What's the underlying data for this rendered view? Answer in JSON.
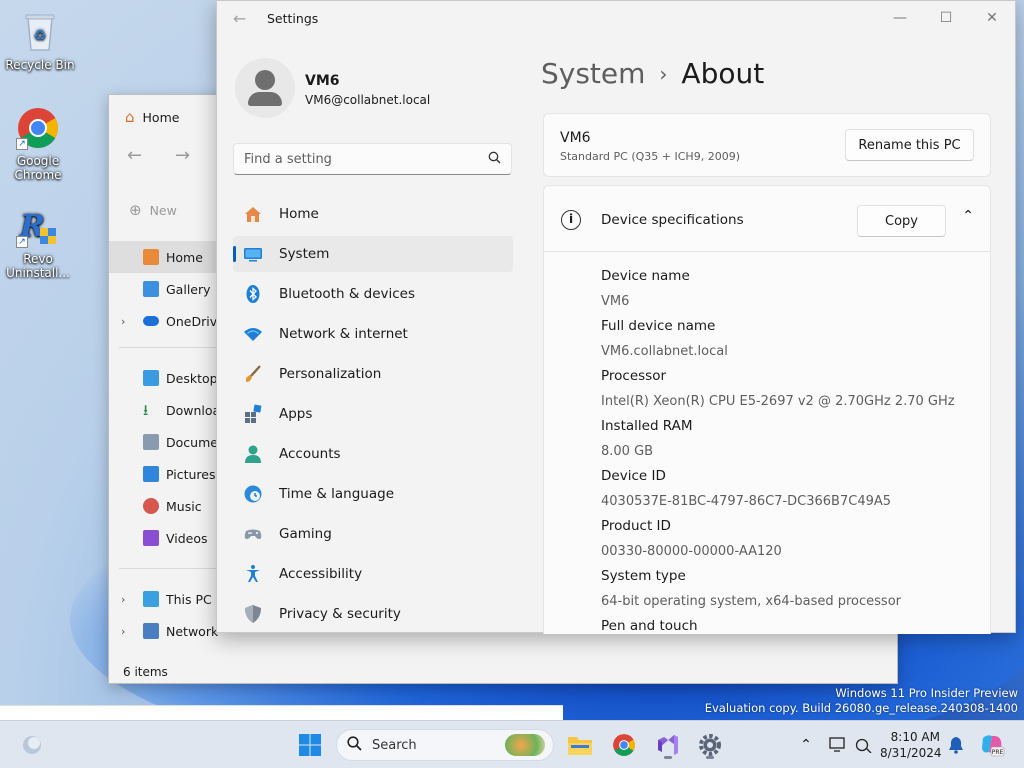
{
  "desktop": {
    "icons": [
      {
        "label": "Recycle Bin"
      },
      {
        "label": "Google Chrome"
      },
      {
        "label": "Revo Uninstall..."
      }
    ]
  },
  "explorer": {
    "tab_title": "Home",
    "new_label": "New",
    "sidebar": [
      {
        "label": "Home",
        "icon": "home-icon"
      },
      {
        "label": "Gallery",
        "icon": "gallery-icon"
      },
      {
        "label": "OneDrive",
        "icon": "cloud-icon"
      },
      {
        "label": "Desktop",
        "icon": "desktop-icon"
      },
      {
        "label": "Downloa",
        "icon": "download-icon"
      },
      {
        "label": "Docume",
        "icon": "document-icon"
      },
      {
        "label": "Pictures",
        "icon": "pictures-icon"
      },
      {
        "label": "Music",
        "icon": "music-icon"
      },
      {
        "label": "Videos",
        "icon": "videos-icon"
      },
      {
        "label": "This PC",
        "icon": "computer-icon"
      },
      {
        "label": "Network",
        "icon": "network-icon"
      }
    ],
    "status": "6 items"
  },
  "settings": {
    "window_title": "Settings",
    "user": {
      "name": "VM6",
      "email": "VM6@collabnet.local"
    },
    "search": {
      "placeholder": "Find a setting"
    },
    "nav": [
      {
        "label": "Home",
        "icon": "home-icon"
      },
      {
        "label": "System",
        "icon": "system-icon"
      },
      {
        "label": "Bluetooth & devices",
        "icon": "bluetooth-icon"
      },
      {
        "label": "Network & internet",
        "icon": "wifi-icon"
      },
      {
        "label": "Personalization",
        "icon": "brush-icon"
      },
      {
        "label": "Apps",
        "icon": "apps-icon"
      },
      {
        "label": "Accounts",
        "icon": "accounts-icon"
      },
      {
        "label": "Time & language",
        "icon": "clock-globe-icon"
      },
      {
        "label": "Gaming",
        "icon": "gamepad-icon"
      },
      {
        "label": "Accessibility",
        "icon": "accessibility-icon"
      },
      {
        "label": "Privacy & security",
        "icon": "shield-icon"
      }
    ],
    "breadcrumb": {
      "parent": "System",
      "current": "About"
    },
    "pc": {
      "name": "VM6",
      "model": "Standard PC (Q35 + ICH9, 2009)",
      "rename_label": "Rename this PC"
    },
    "specs": {
      "title": "Device specifications",
      "copy_label": "Copy",
      "rows": [
        {
          "label": "Device name",
          "value": "VM6"
        },
        {
          "label": "Full device name",
          "value": "VM6.collabnet.local"
        },
        {
          "label": "Processor",
          "value": "Intel(R) Xeon(R) CPU E5-2697 v2 @ 2.70GHz   2.70 GHz"
        },
        {
          "label": "Installed RAM",
          "value": "8.00 GB"
        },
        {
          "label": "Device ID",
          "value": "4030537E-81BC-4797-86C7-DC366B7C49A5"
        },
        {
          "label": "Product ID",
          "value": "00330-80000-00000-AA120"
        },
        {
          "label": "System type",
          "value": "64-bit operating system, x64-based processor"
        },
        {
          "label": "Pen and touch",
          "value": ""
        }
      ]
    }
  },
  "watermark": {
    "line1": "Windows 11 Pro Insider Preview",
    "line2": "Evaluation copy. Build 26080.ge_release.240308-1400"
  },
  "taskbar": {
    "search_label": "Search",
    "time": "8:10 AM",
    "date": "8/31/2024"
  }
}
